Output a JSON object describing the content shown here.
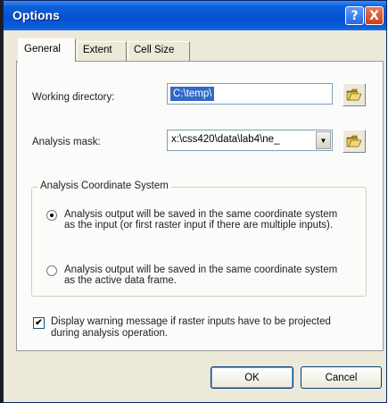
{
  "window": {
    "title": "Options",
    "help_glyph": "?",
    "close_glyph": "X"
  },
  "tabs": [
    {
      "label": "General",
      "active": true
    },
    {
      "label": "Extent",
      "active": false
    },
    {
      "label": "Cell Size",
      "active": false
    }
  ],
  "general": {
    "working_directory": {
      "label": "Working directory:",
      "value": "C:\\temp\\"
    },
    "analysis_mask": {
      "label": "Analysis mask:",
      "value": "x:\\css420\\data\\lab4\\ne_"
    },
    "coordinate_system": {
      "title": "Analysis Coordinate System",
      "options": [
        {
          "text": "Analysis output will be saved in the same coordinate system as the input (or first raster input if there are multiple inputs).",
          "checked": true
        },
        {
          "text": "Analysis output will be saved in the same coordinate system as the active data frame.",
          "checked": false
        }
      ]
    },
    "warning_checkbox": {
      "text": "Display warning message if raster inputs have to be projected during analysis operation.",
      "checked": true,
      "mark": "✔"
    }
  },
  "buttons": {
    "ok": "OK",
    "cancel": "Cancel"
  },
  "icons": {
    "folder": "folder-open-icon",
    "dropdown": "chevron-down-icon"
  }
}
